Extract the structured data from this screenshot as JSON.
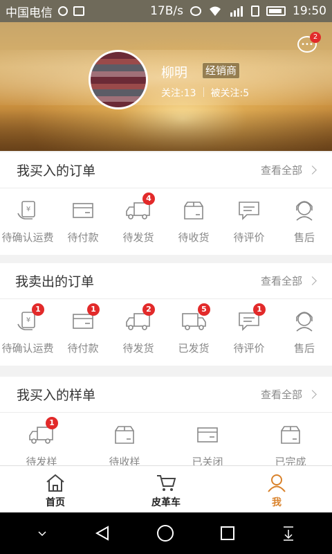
{
  "status_bar": {
    "carrier": "中国电信",
    "speed": "17B/s",
    "time": "19:50"
  },
  "profile": {
    "name": "柳明",
    "role": "经销商",
    "following": "关注:13",
    "followers": "被关注:5",
    "messages_badge": "2"
  },
  "sections": [
    {
      "title": "我买入的订单",
      "view_all": "查看全部",
      "items": [
        {
          "label": "待确认运费",
          "icon": "yen-hand-icon",
          "badge": ""
        },
        {
          "label": "待付款",
          "icon": "card-icon",
          "badge": ""
        },
        {
          "label": "待发货",
          "icon": "truck-icon",
          "badge": "4"
        },
        {
          "label": "待收货",
          "icon": "box-icon",
          "badge": ""
        },
        {
          "label": "待评价",
          "icon": "comment-icon",
          "badge": ""
        },
        {
          "label": "售后",
          "icon": "service-icon",
          "badge": ""
        }
      ]
    },
    {
      "title": "我卖出的订单",
      "view_all": "查看全部",
      "items": [
        {
          "label": "待确认运费",
          "icon": "yen-hand-icon",
          "badge": "1"
        },
        {
          "label": "待付款",
          "icon": "card-icon",
          "badge": "1"
        },
        {
          "label": "待发货",
          "icon": "truck-icon",
          "badge": "2"
        },
        {
          "label": "已发货",
          "icon": "shipped-truck-icon",
          "badge": "5"
        },
        {
          "label": "待评价",
          "icon": "comment-icon",
          "badge": "1"
        },
        {
          "label": "售后",
          "icon": "service-icon",
          "badge": ""
        }
      ]
    },
    {
      "title": "我买入的样单",
      "view_all": "查看全部",
      "items": [
        {
          "label": "待发样",
          "icon": "truck-icon",
          "badge": "1"
        },
        {
          "label": "待收样",
          "icon": "box-icon",
          "badge": ""
        },
        {
          "label": "已关闭",
          "icon": "card-icon",
          "badge": ""
        },
        {
          "label": "已完成",
          "icon": "box-icon",
          "badge": ""
        }
      ]
    }
  ],
  "bottom_nav": [
    {
      "label": "首页",
      "icon": "home-icon",
      "active": false
    },
    {
      "label": "皮革车",
      "icon": "cart-icon",
      "active": false
    },
    {
      "label": "我",
      "icon": "user-icon",
      "active": true
    }
  ],
  "colors": {
    "accent": "#d9822b",
    "badge": "#e22a2a",
    "icon_gray": "#888888"
  }
}
